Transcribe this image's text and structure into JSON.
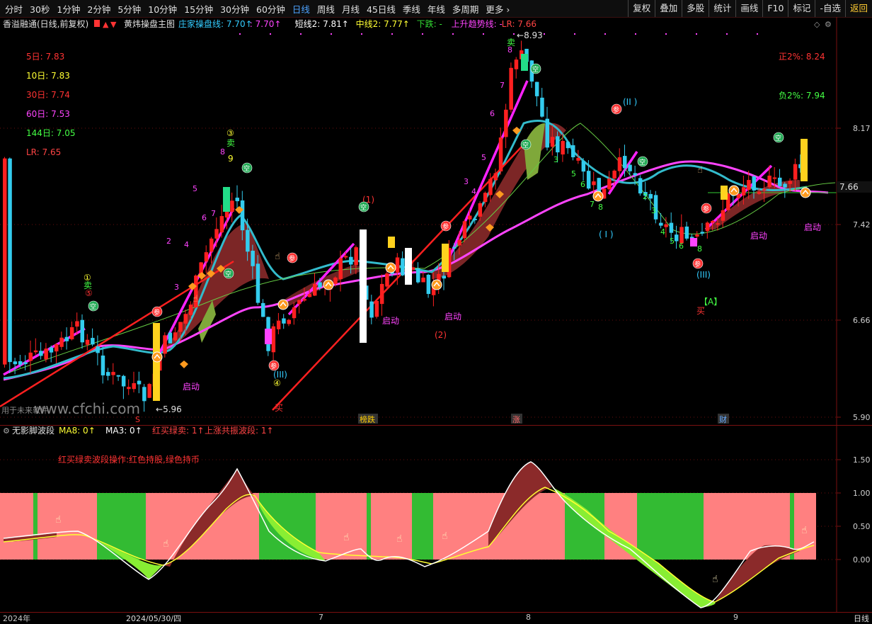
{
  "toolbar": {
    "timeframes": [
      "分时",
      "30秒",
      "1分钟",
      "2分钟",
      "5分钟",
      "10分钟",
      "15分钟",
      "30分钟",
      "60分钟",
      "日线",
      "周线",
      "月线",
      "45日线",
      "季线",
      "年线",
      "多周期",
      "更多"
    ],
    "active_timeframe": "日线",
    "right_buttons": [
      "复权",
      "叠加",
      "多股",
      "统计",
      "画线",
      "F10",
      "标记",
      "-自选",
      "返回"
    ]
  },
  "header": {
    "stock": "香溢融通(日线,前复权)",
    "indicator": "黄炜操盘主图",
    "items": [
      {
        "text": "庄家操盘线: 7.70↑",
        "color": "#33ccff"
      },
      {
        "text": ": 7.70↑",
        "color": "#ff44ff"
      },
      {
        "text": "短线2: 7.81↑",
        "color": "#ffffff"
      },
      {
        "text": "中线2: 7.77↑",
        "color": "#ffff33"
      },
      {
        "text": "下跌: -",
        "color": "#33dd33"
      },
      {
        "text": "上升趋势线: -",
        "color": "#ff44ff"
      },
      {
        "text": "LR: 7.66",
        "color": "#ff4444"
      }
    ]
  },
  "ma_panel": [
    {
      "label": "5日: 7.83",
      "color": "#ff3333"
    },
    {
      "label": "10日: 7.83",
      "color": "#ffff33"
    },
    {
      "label": "30日: 7.74",
      "color": "#ff3333"
    },
    {
      "label": "60日: 7.53",
      "color": "#ff44ff"
    },
    {
      "label": "144日: 7.05",
      "color": "#44ff44"
    },
    {
      "label": "LR: 7.65",
      "color": "#ff4444"
    }
  ],
  "band_labels": {
    "pos": "正2%: 8.24",
    "neg": "负2%: 7.94"
  },
  "price_axis": {
    "ticks": [
      "8.17",
      "7.42",
      "6.66",
      "5.90"
    ],
    "current": "7.66"
  },
  "extremes": {
    "high": "8.93",
    "low": "5.96"
  },
  "watermark": "www.cfchi.com",
  "watermark_small": "用于未来软件",
  "main_annotations": {
    "qidong": "启动",
    "buy": "买",
    "sell": "卖",
    "marker_a": "【A】",
    "wave_I": "( I )",
    "wave_II": "(II )",
    "wave_III": "(III)",
    "wave_1": "(1)",
    "wave_2": "(2)",
    "circled_1": "①",
    "circled_3": "③",
    "circled_4": "④",
    "circled_5": "⑤",
    "circled_9": "9",
    "num_2": "2",
    "num_3": "3",
    "num_4": "4",
    "num_5": "5",
    "num_6": "6",
    "num_7": "7",
    "num_8": "8",
    "event_bangdie": "榜跌",
    "event_zhang": "涨",
    "event_cai": "财",
    "event_s": "S"
  },
  "sub_header": {
    "name": "无影脚波段",
    "items": [
      {
        "text": "MA8: 0↑",
        "color": "#ffff33"
      },
      {
        "text": "MA3: 0↑",
        "color": "#ffffff"
      },
      {
        "text": "红买绿卖: 1↑",
        "color": "#ff4444"
      },
      {
        "text": "上涨共振波段: 1↑",
        "color": "#ff4444"
      }
    ],
    "note": "红买绿卖波段操作:红色持股,绿色持币"
  },
  "sub_axis": {
    "ticks": [
      "1.50",
      "1.00",
      "0.50",
      "0.00"
    ]
  },
  "dates": [
    "2024年",
    "2024/05/30/四",
    "7",
    "8",
    "9"
  ],
  "period_label": "日线",
  "colors": {
    "up": "#ff2020",
    "down": "#33ccee",
    "bg": "#000000",
    "grid": "#6a0e0e",
    "pink": "#ff8080",
    "green": "#33bb33"
  }
}
